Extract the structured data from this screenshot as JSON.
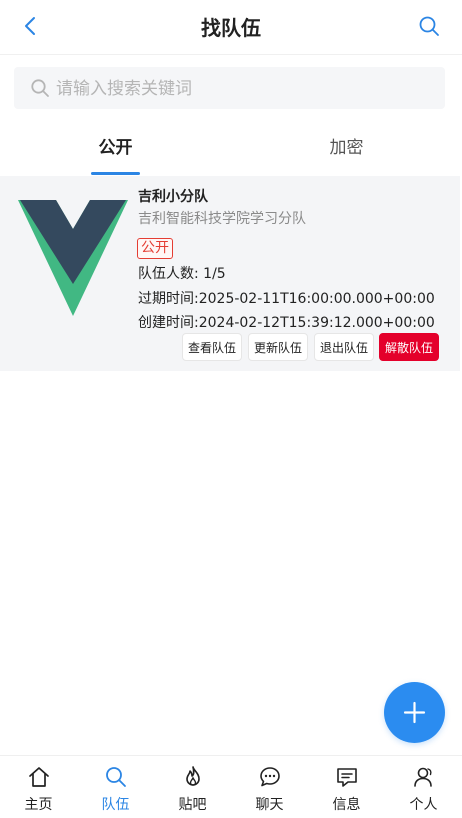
{
  "nav": {
    "title": "找队伍",
    "back_icon": "chevron-left-icon",
    "search_icon": "search-icon"
  },
  "search": {
    "placeholder": "请输入搜索关键词",
    "value": ""
  },
  "tabs": [
    {
      "label": "公开",
      "active": true
    },
    {
      "label": "加密",
      "active": false
    }
  ],
  "team": {
    "name": "吉利小分队",
    "description": "吉利智能科技学院学习分队",
    "badge": "公开",
    "member_count": "队伍人数: 1/5",
    "expire_time": "过期时间:2025-02-11T16:00:00.000+00:00",
    "create_time": "创建时间:2024-02-12T15:39:12.000+00:00",
    "buttons": {
      "view": "查看队伍",
      "update": "更新队伍",
      "leave": "退出队伍",
      "dissolve": "解散队伍"
    }
  },
  "fab": {
    "icon": "plus-icon"
  },
  "tabbar": [
    {
      "label": "主页",
      "icon": "home-icon",
      "active": false
    },
    {
      "label": "队伍",
      "icon": "search-icon",
      "active": true
    },
    {
      "label": "贴吧",
      "icon": "fire-icon",
      "active": false
    },
    {
      "label": "聊天",
      "icon": "chat-icon",
      "active": false
    },
    {
      "label": "信息",
      "icon": "message-icon",
      "active": false
    },
    {
      "label": "个人",
      "icon": "user-icon",
      "active": false
    }
  ],
  "colors": {
    "accent": "#2b85e4",
    "danger": "#e4002b",
    "badge": "#e43d33",
    "card_bg": "#f4f5f7"
  }
}
